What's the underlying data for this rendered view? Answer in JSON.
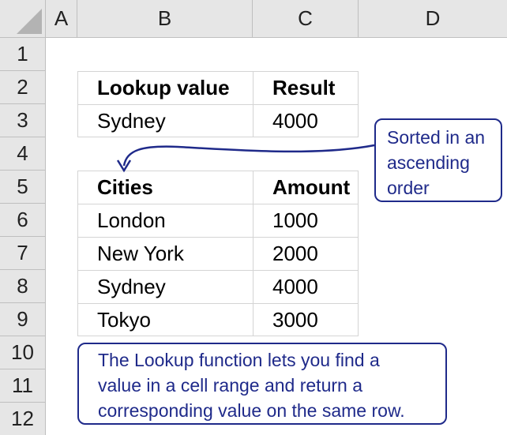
{
  "columns": [
    "A",
    "B",
    "C",
    "D"
  ],
  "rows": [
    "1",
    "2",
    "3",
    "4",
    "5",
    "6",
    "7",
    "8",
    "9",
    "10",
    "11",
    "12"
  ],
  "lookup_table": {
    "header": [
      "Lookup value",
      "Result"
    ],
    "row": [
      "Sydney",
      "4000"
    ]
  },
  "data_table": {
    "header": [
      "Cities",
      "Amount"
    ],
    "rows": [
      [
        "London",
        "1000"
      ],
      [
        "New York",
        "2000"
      ],
      [
        "Sydney",
        "4000"
      ],
      [
        "Tokyo",
        "3000"
      ]
    ]
  },
  "callout_sorted": {
    "lines": [
      "Sorted in an",
      "ascending",
      "order"
    ]
  },
  "callout_info": {
    "lines": [
      "The Lookup function lets you find a",
      "value in a cell range and return a",
      "corresponding value on the same row."
    ]
  },
  "colors": {
    "callout": "#1f2a8a",
    "header_bg": "#e6e6e6",
    "grid": "#d4d4d4"
  }
}
